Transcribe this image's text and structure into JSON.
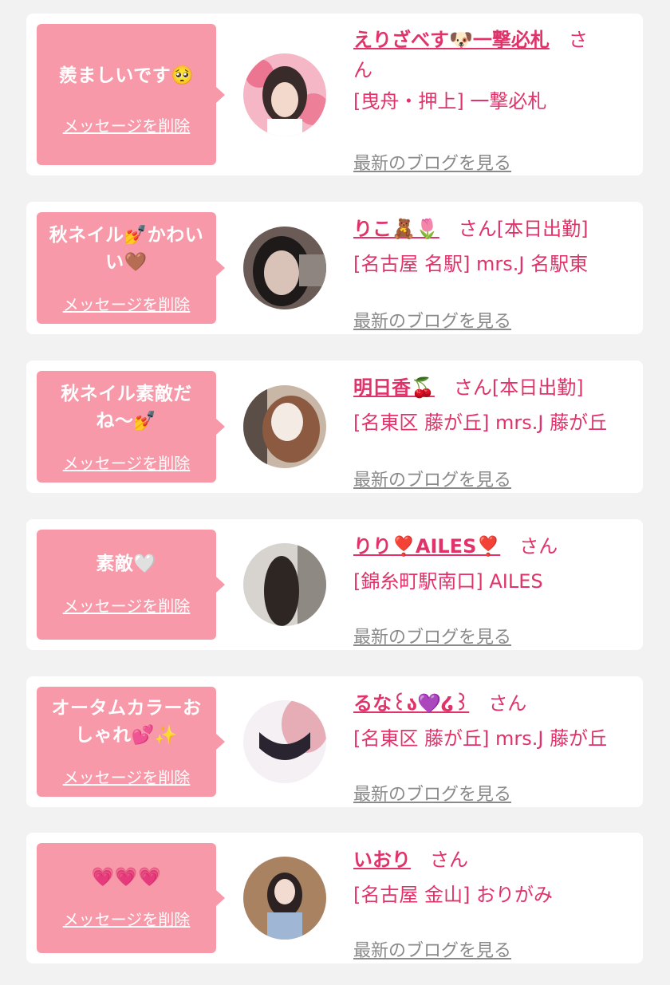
{
  "items": [
    {
      "message": "羨ましいです🥺",
      "delete_label": "メッセージを削除",
      "name": "えりざべす🐶一撃必札",
      "san": "さん",
      "san_tail": "ん",
      "shop": "[曳舟・押上] 一撃必札",
      "blog": "最新のブログを見る",
      "avatar_colors": [
        "#f5b7c5",
        "#e85a7c",
        "#3a2b2b"
      ]
    },
    {
      "message_line1": "秋ネイル💅かわい",
      "message_line2": "い🤎",
      "delete_label": "メッセージを削除",
      "name": "りこ🧸🌷",
      "san": "さん[本日出勤]",
      "shop": "[名古屋 名駅] mrs.J 名駅東",
      "blog": "最新のブログを見る",
      "avatar_colors": [
        "#6b5b57",
        "#d9c2b8",
        "#1e1a1a"
      ]
    },
    {
      "message_line1": "秋ネイル素敵だ",
      "message_line2": "ね〜💅",
      "delete_label": "メッセージを削除",
      "name": "明日香🍒",
      "san": "さん[本日出勤]",
      "shop": "[名東区 藤が丘] mrs.J 藤が丘",
      "blog": "最新のブログを見る",
      "avatar_colors": [
        "#c8b6a6",
        "#8c5a40",
        "#f3ebe4"
      ]
    },
    {
      "message": "素敵🤍",
      "delete_label": "メッセージを削除",
      "name": "りり❣️AILES❣️",
      "san": "さん",
      "shop": "[錦糸町駅南口] AILES",
      "blog": "最新のブログを見る",
      "avatar_colors": [
        "#d7d4d0",
        "#2e2622",
        "#8f8984"
      ]
    },
    {
      "message_line1": "オータムカラーお",
      "message_line2": "しゃれ💕✨",
      "delete_label": "メッセージを削除",
      "name": "るな꒰ა💜໒꒱",
      "san": "さん",
      "shop": "[名東区 藤が丘] mrs.J 藤が丘",
      "blog": "最新のブログを見る",
      "avatar_colors": [
        "#f5f0f4",
        "#2a2430",
        "#d96a7a"
      ]
    },
    {
      "message": "💗💗💗",
      "delete_label": "メッセージを削除",
      "name": "いおり",
      "san": "さん",
      "shop": "[名古屋 金山] おりがみ",
      "blog": "最新のブログを見る",
      "avatar_colors": [
        "#a98262",
        "#f2dcd2",
        "#2c2222"
      ]
    }
  ]
}
